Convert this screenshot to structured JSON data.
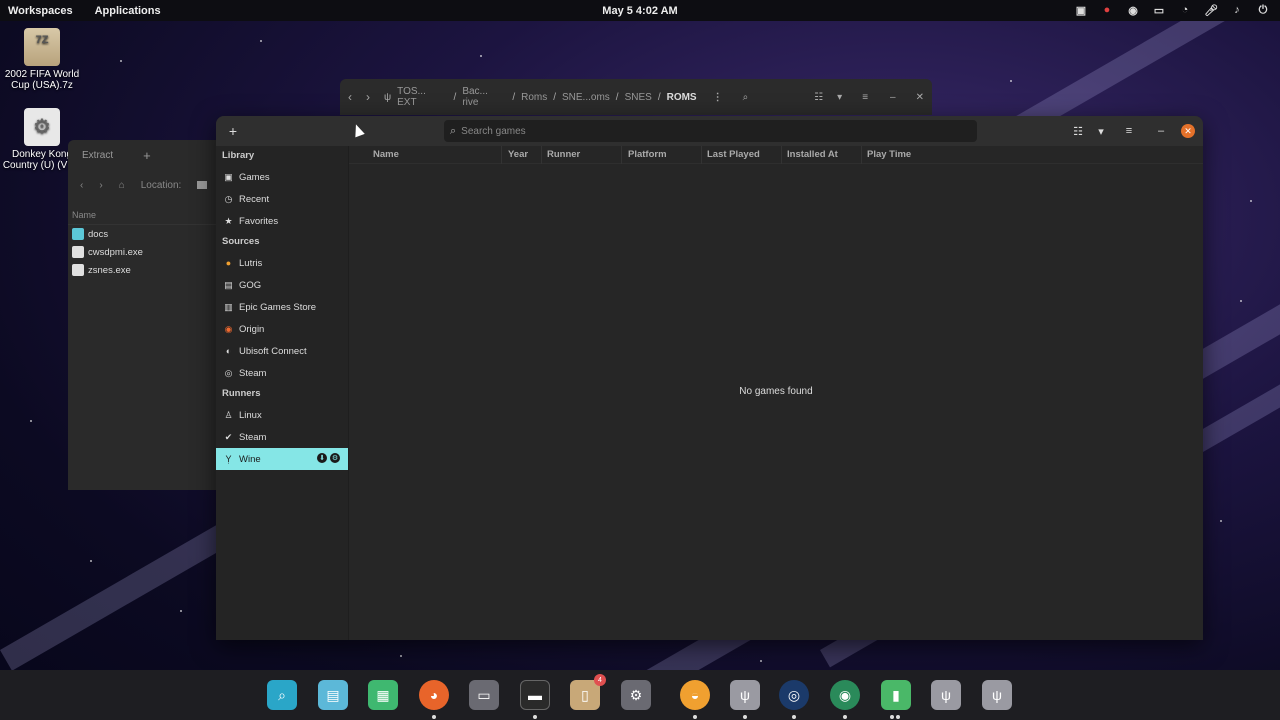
{
  "topbar": {
    "workspaces": "Workspaces",
    "applications": "Applications",
    "clock": "May 5   4:02 AM"
  },
  "desktop": {
    "icons": [
      {
        "label": "2002 FIFA World Cup (USA).7z",
        "badge": "7Z"
      },
      {
        "label": "Donkey Kong Country (U) (V1.2"
      }
    ]
  },
  "file_manager": {
    "breadcrumbs": [
      "TOS... EXT",
      "Bac... rive",
      "Roms",
      "SNE...oms",
      "SNES",
      "ROMS"
    ]
  },
  "archive": {
    "tab": "Extract",
    "location_label": "Location:",
    "column_name": "Name",
    "files": [
      {
        "name": "docs",
        "type": "folder"
      },
      {
        "name": "cwsdpmi.exe",
        "type": "exe"
      },
      {
        "name": "zsnes.exe",
        "type": "exe"
      }
    ]
  },
  "lutris": {
    "search_placeholder": "Search games",
    "sidebar": {
      "library_title": "Library",
      "library": [
        "Games",
        "Recent",
        "Favorites"
      ],
      "sources_title": "Sources",
      "sources": [
        "Lutris",
        "GOG",
        "Epic Games Store",
        "Origin",
        "Ubisoft Connect",
        "Steam"
      ],
      "runners_title": "Runners",
      "runners": [
        "Linux",
        "Steam",
        "Wine"
      ]
    },
    "columns": [
      "Name",
      "Year",
      "Runner",
      "Platform",
      "Last Played",
      "Installed At",
      "Play Time"
    ],
    "empty_message": "No games found"
  },
  "dock": {
    "items": [
      "search",
      "files-view",
      "apps-grid",
      "firefox",
      "files",
      "terminal",
      "archive",
      "settings",
      "lutris",
      "usb",
      "steam",
      "browser",
      "archive-manager",
      "usb-2",
      "usb-3"
    ],
    "badge_count": "4"
  },
  "colors": {
    "selected": "#85e6e6",
    "close": "#e4712a"
  }
}
